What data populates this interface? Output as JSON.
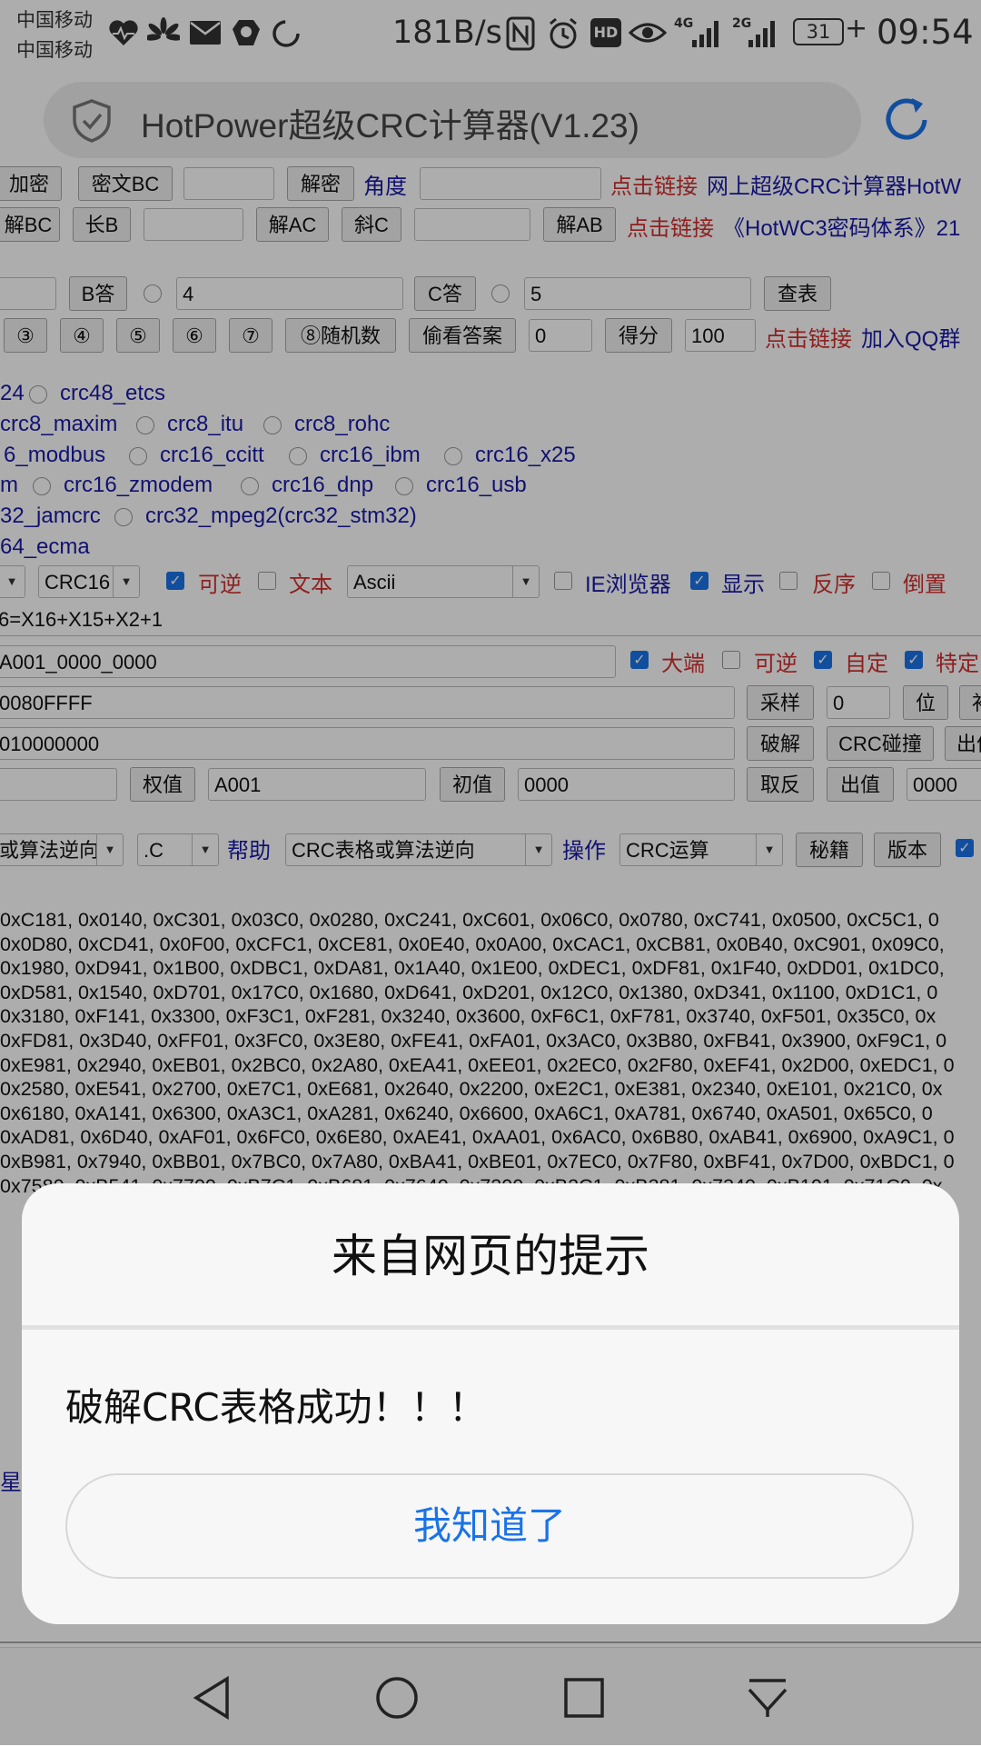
{
  "status_bar": {
    "carrier1": "中国移动",
    "carrier2": "中国移动",
    "speed": "181B/s",
    "battery": "31",
    "time": "09:54",
    "sig1_label": "4G",
    "sig2_label": "2G",
    "hd_label": "HD"
  },
  "browser": {
    "title": "HotPower超级CRC计算器(V1.23)"
  },
  "page": {
    "row1": {
      "btn_encrypt": "加密",
      "btn_cipher_bc": "密文BC",
      "btn_decrypt": "解密",
      "angle_label": "角度",
      "link_prefix": "点击链接",
      "link_text": "网上超级CRC计算器HotW"
    },
    "row2": {
      "btn_jie_bc": "解BC",
      "btn_chang_b": "长B",
      "btn_jie_ac": "解AC",
      "btn_xie_c": "斜C",
      "btn_jie_ab": "解AB",
      "link_prefix": "点击链接",
      "link_text": "《HotWC3密码体系》21"
    },
    "row3": {
      "btn_b_answer": "B答",
      "input_b": "4",
      "btn_c_answer": "C答",
      "input_c": "5",
      "btn_lookup": "查表"
    },
    "row4": {
      "circ3": "③",
      "circ4": "④",
      "circ5": "⑤",
      "circ6": "⑥",
      "circ7": "⑦",
      "btn_random": "⑧随机数",
      "btn_peek": "偷看答案",
      "input_zero": "0",
      "btn_score": "得分",
      "input_score": "100",
      "link_prefix": "点击链接",
      "link_text": "加入QQ群"
    },
    "algos": {
      "r1a": "24",
      "r1b": "crc48_etcs",
      "r2a": "crc8_maxim",
      "r2b": "crc8_itu",
      "r2c": "crc8_rohc",
      "r3a": "6_modbus",
      "r3b": "crc16_ccitt",
      "r3c": "crc16_ibm",
      "r3d": "crc16_x25",
      "r4a": "m",
      "r4b": "crc16_zmodem",
      "r4c": "crc16_dnp",
      "r4d": "crc16_usb",
      "r5a": "32_jamcrc",
      "r5b": "crc32_mpeg2(crc32_stm32)",
      "r6a": "64_ecma"
    },
    "opts": {
      "select_crc": "CRC16",
      "reversible": "可逆",
      "text": "文本",
      "select_enc": "Ascii",
      "ie_browser": "IE浏览器",
      "display": "显示",
      "reverse_order": "反序",
      "invert": "倒置"
    },
    "poly_field": "6=X16+X15+X2+1",
    "row_hex1": {
      "value": "A001_0000_0000",
      "big_endian": "大端",
      "reversible": "可逆",
      "custom": "自定",
      "special": "特定"
    },
    "row_hex2": {
      "value": "0080FFFF",
      "btn_sample": "采样",
      "input_bits": "0",
      "btn_bit": "位",
      "btn_cut": "补"
    },
    "row_hex3": {
      "value": "010000000",
      "btn_crack": "破解",
      "btn_collide": "CRC碰撞",
      "btn_out": "出值"
    },
    "row_hex4": {
      "btn_weight": "权值",
      "input_weight": "A001",
      "btn_init": "初值",
      "input_init": "0000",
      "btn_negate": "取反",
      "btn_outval": "出值",
      "input_out": "0000"
    },
    "row_menu": {
      "select_mode": "或算法逆向",
      "select_lang": ".C",
      "help_label": "帮助",
      "select_help": "CRC表格或算法逆向",
      "op_label": "操作",
      "select_op": "CRC运算",
      "btn_secret": "秘籍",
      "btn_version": "版本"
    },
    "table_lines": [
      "0xC181, 0x0140, 0xC301, 0x03C0, 0x0280, 0xC241, 0xC601, 0x06C0, 0x0780, 0xC741, 0x0500, 0xC5C1, 0",
      "0x0D80, 0xCD41, 0x0F00, 0xCFC1, 0xCE81, 0x0E40, 0x0A00, 0xCAC1, 0xCB81, 0x0B40, 0xC901, 0x09C0,",
      "0x1980, 0xD941, 0x1B00, 0xDBC1, 0xDA81, 0x1A40, 0x1E00, 0xDEC1, 0xDF81, 0x1F40, 0xDD01, 0x1DC0,",
      "0xD581, 0x1540, 0xD701, 0x17C0, 0x1680, 0xD641, 0xD201, 0x12C0, 0x1380, 0xD341, 0x1100, 0xD1C1, 0",
      "0x3180, 0xF141, 0x3300, 0xF3C1, 0xF281, 0x3240, 0x3600, 0xF6C1, 0xF781, 0x3740, 0xF501, 0x35C0, 0x",
      "0xFD81, 0x3D40, 0xFF01, 0x3FC0, 0x3E80, 0xFE41, 0xFA01, 0x3AC0, 0x3B80, 0xFB41, 0x3900, 0xF9C1, 0",
      "0xE981, 0x2940, 0xEB01, 0x2BC0, 0x2A80, 0xEA41, 0xEE01, 0x2EC0, 0x2F80, 0xEF41, 0x2D00, 0xEDC1, 0",
      "0x2580, 0xE541, 0x2700, 0xE7C1, 0xE681, 0x2640, 0x2200, 0xE2C1, 0xE381, 0x2340, 0xE101, 0x21C0, 0x",
      "0x6180, 0xA141, 0x6300, 0xA3C1, 0xA281, 0x6240, 0x6600, 0xA6C1, 0xA781, 0x6740, 0xA501, 0x65C0, 0",
      "0xAD81, 0x6D40, 0xAF01, 0x6FC0, 0x6E80, 0xAE41, 0xAA01, 0x6AC0, 0x6B80, 0xAB41, 0x6900, 0xA9C1, 0",
      "0xB981, 0x7940, 0xBB01, 0x7BC0, 0x7A80, 0xBA41, 0xBE01, 0x7EC0, 0x7F80, 0xBF41, 0x7D00, 0xBDC1, 0",
      "0x7580, 0xB541, 0x7700, 0xB7C1, 0xB681, 0x7640, 0x7200, 0xB2C1, 0xB381, 0x7340, 0xB101, 0x71C0, 0x"
    ],
    "footer_link": "星"
  },
  "dialog": {
    "title": "来自网页的提示",
    "message": "破解CRC表格成功！！！",
    "ok_button": "我知道了"
  },
  "colors": {
    "link_blue": "#1a1aa8",
    "label_red": "#d32f2f",
    "accent": "#1a73e8",
    "overlay": "rgba(0,0,0,0.32)"
  }
}
